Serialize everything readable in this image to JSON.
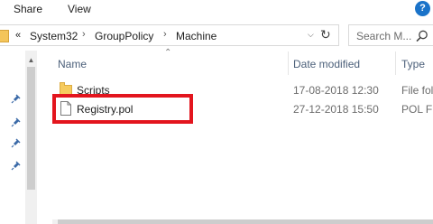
{
  "ribbon": {
    "tabs": [
      {
        "label": "Share"
      },
      {
        "label": "View"
      }
    ]
  },
  "address_bar": {
    "overflow": "«",
    "crumbs": [
      "System32",
      "GroupPolicy",
      "Machine"
    ],
    "separator": "›"
  },
  "search": {
    "placeholder": "Search M..."
  },
  "columns": {
    "name": "Name",
    "date_modified": "Date modified",
    "type": "Type"
  },
  "files": [
    {
      "name": "Scripts",
      "date": "17-08-2018 12:30",
      "type": "File fol",
      "icon": "folder-icon"
    },
    {
      "name": "Registry.pol",
      "date": "27-12-2018 15:50",
      "type": "POL Fi",
      "icon": "file-icon"
    }
  ],
  "colors": {
    "highlight": "#e3151e",
    "header_text": "#4c607a",
    "folder": "#f6cb5e"
  }
}
